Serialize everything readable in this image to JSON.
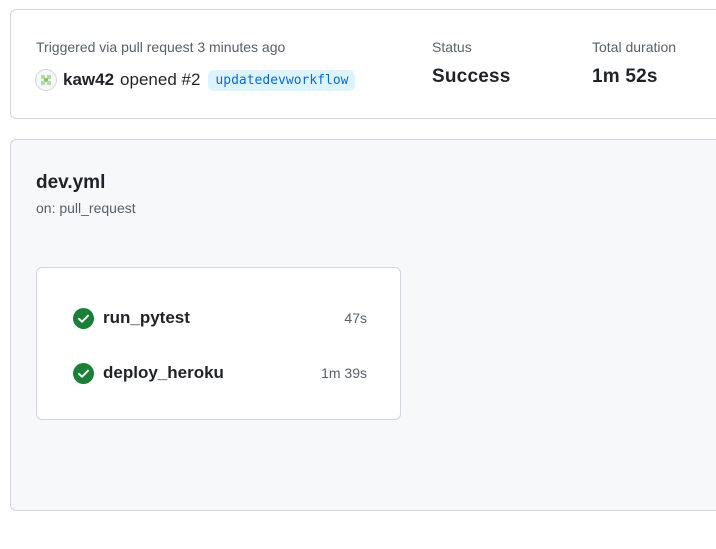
{
  "summary": {
    "triggered_text": "Triggered via pull request 3 minutes ago",
    "actor": "kaw42",
    "opened_text": "opened #2",
    "branch": "updatedevworkflow",
    "status_label": "Status",
    "status_value": "Success",
    "duration_label": "Total duration",
    "duration_value": "1m 52s"
  },
  "workflow": {
    "name": "dev.yml",
    "trigger": "on: pull_request",
    "jobs": [
      {
        "name": "run_pytest",
        "duration": "47s",
        "status": "success"
      },
      {
        "name": "deploy_heroku",
        "duration": "1m 39s",
        "status": "success"
      }
    ]
  },
  "colors": {
    "success": "#1a7f37",
    "link": "#0969da",
    "branch_bg": "#ddf4ff",
    "panel_bg": "#f6f8fa"
  }
}
